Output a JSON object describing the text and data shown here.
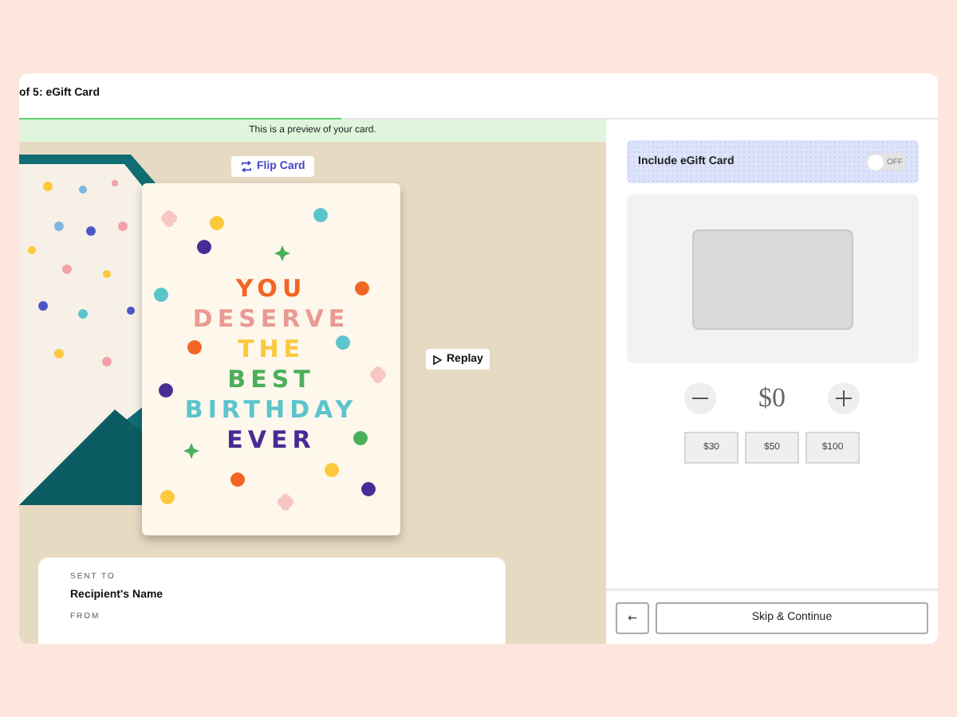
{
  "header": {
    "title": "of 5: eGift Card",
    "progress": {
      "level": 0.35
    }
  },
  "preview": {
    "banner": "This is a preview of your card.",
    "flip_button": "Flip Card",
    "replay_button": "Replay",
    "card_lines": [
      {
        "text": "YOU",
        "color": "#f26522"
      },
      {
        "text": "DESERVE",
        "color": "#ea9a92"
      },
      {
        "text": "THE",
        "color": "#fcc83c"
      },
      {
        "text": "BEST",
        "color": "#4caf5a"
      },
      {
        "text": "BIRTHDAY",
        "color": "#5bc4cc"
      },
      {
        "text": "EVER",
        "color": "#4a2a95"
      }
    ],
    "details": {
      "sent_to_label": "SENT TO",
      "recipient": "Recipient's Name",
      "from_label": "FROM"
    }
  },
  "gift": {
    "toggle": {
      "label": "Include eGift Card",
      "on": false,
      "state_text": "OFF"
    },
    "amount": "$0",
    "presets": [
      "$30",
      "$50",
      "$100"
    ]
  },
  "footer": {
    "back": "←",
    "continue": "Skip & Continue"
  }
}
